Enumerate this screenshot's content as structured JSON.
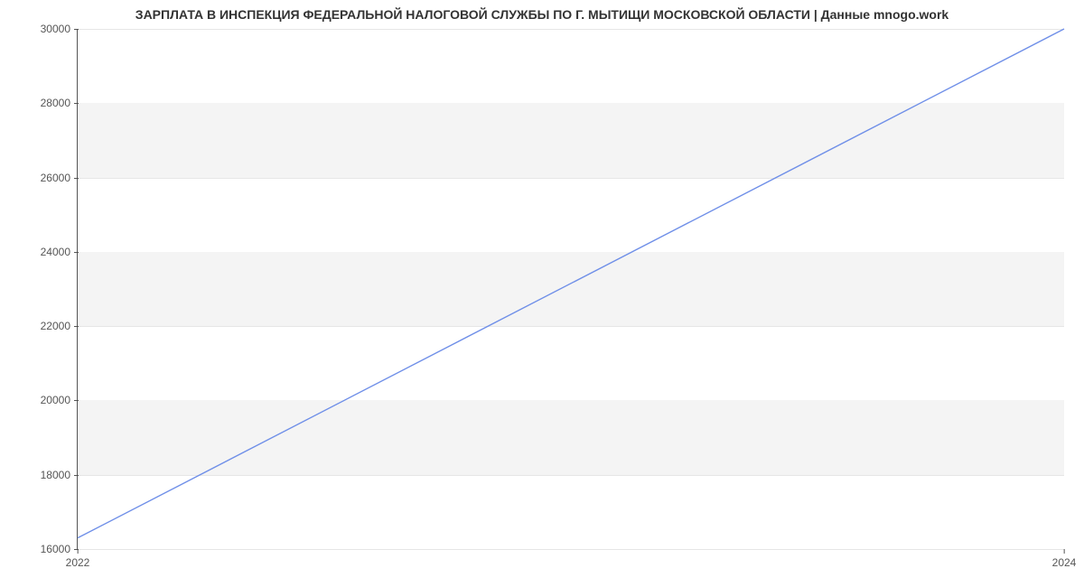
{
  "chart_data": {
    "type": "line",
    "title": "ЗАРПЛАТА В ИНСПЕКЦИЯ ФЕДЕРАЛЬНОЙ НАЛОГОВОЙ СЛУЖБЫ ПО Г. МЫТИЩИ МОСКОВСКОЙ ОБЛАСТИ | Данные mnogo.work",
    "xlabel": "",
    "ylabel": "",
    "x_ticks": [
      "2022",
      "2024"
    ],
    "y_ticks": [
      16000,
      18000,
      20000,
      22000,
      24000,
      26000,
      28000,
      30000
    ],
    "xlim": [
      2022,
      2024
    ],
    "ylim": [
      16000,
      30000
    ],
    "x": [
      2022,
      2024
    ],
    "values": [
      16300,
      30000
    ],
    "grid": true,
    "line_color": "#6f8fe8"
  }
}
